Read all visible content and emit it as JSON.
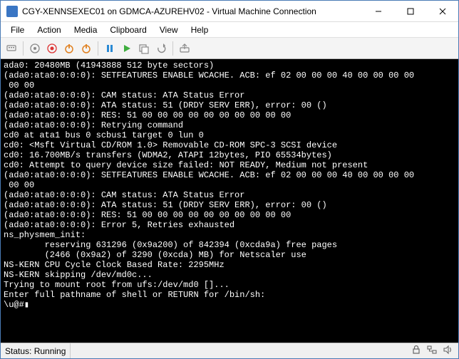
{
  "window": {
    "title": "CGY-XENNSEXEC01 on GDMCA-AZUREHV02 - Virtual Machine Connection"
  },
  "menu": {
    "items": [
      "File",
      "Action",
      "Media",
      "Clipboard",
      "View",
      "Help"
    ]
  },
  "toolbar": {
    "icons": [
      "ctrl-alt-del-icon",
      "start-icon",
      "turnoff-icon",
      "shutdown-icon",
      "reset-icon",
      "pause-icon",
      "play-icon",
      "checkpoint-icon",
      "revert-icon",
      "share-icon"
    ]
  },
  "console_lines": [
    "ada0: 20480MB (41943888 512 byte sectors)",
    "(ada0:ata0:0:0:0): SETFEATURES ENABLE WCACHE. ACB: ef 02 00 00 00 40 00 00 00 00",
    " 00 00",
    "(ada0:ata0:0:0:0): CAM status: ATA Status Error",
    "(ada0:ata0:0:0:0): ATA status: 51 (DRDY SERV ERR), error: 00 ()",
    "(ada0:ata0:0:0:0): RES: 51 00 00 00 00 00 00 00 00 00 00",
    "(ada0:ata0:0:0:0): Retrying command",
    "cd0 at ata1 bus 0 scbus1 target 0 lun 0",
    "cd0: <Msft Virtual CD/ROM 1.0> Removable CD-ROM SPC-3 SCSI device",
    "cd0: 16.700MB/s transfers (WDMA2, ATAPI 12bytes, PIO 65534bytes)",
    "cd0: Attempt to query device size failed: NOT READY, Medium not present",
    "(ada0:ata0:0:0:0): SETFEATURES ENABLE WCACHE. ACB: ef 02 00 00 00 40 00 00 00 00",
    " 00 00",
    "(ada0:ata0:0:0:0): CAM status: ATA Status Error",
    "(ada0:ata0:0:0:0): ATA status: 51 (DRDY SERV ERR), error: 00 ()",
    "(ada0:ata0:0:0:0): RES: 51 00 00 00 00 00 00 00 00 00 00",
    "(ada0:ata0:0:0:0): Error 5, Retries exhausted",
    "ns_physmem_init:",
    "        reserving 631296 (0x9a200) of 842394 (0xcda9a) free pages",
    "        (2466 (0x9a2) of 3290 (0xcda) MB) for Netscaler use",
    "NS-KERN CPU Cycle Clock Based Rate: 2295MHz",
    "NS-KERN skipping /dev/md0c...",
    "Trying to mount root from ufs:/dev/md0 []...",
    "Enter full pathname of shell or RETURN for /bin/sh:",
    "\\u@#▮"
  ],
  "status": {
    "text": "Status: Running"
  }
}
